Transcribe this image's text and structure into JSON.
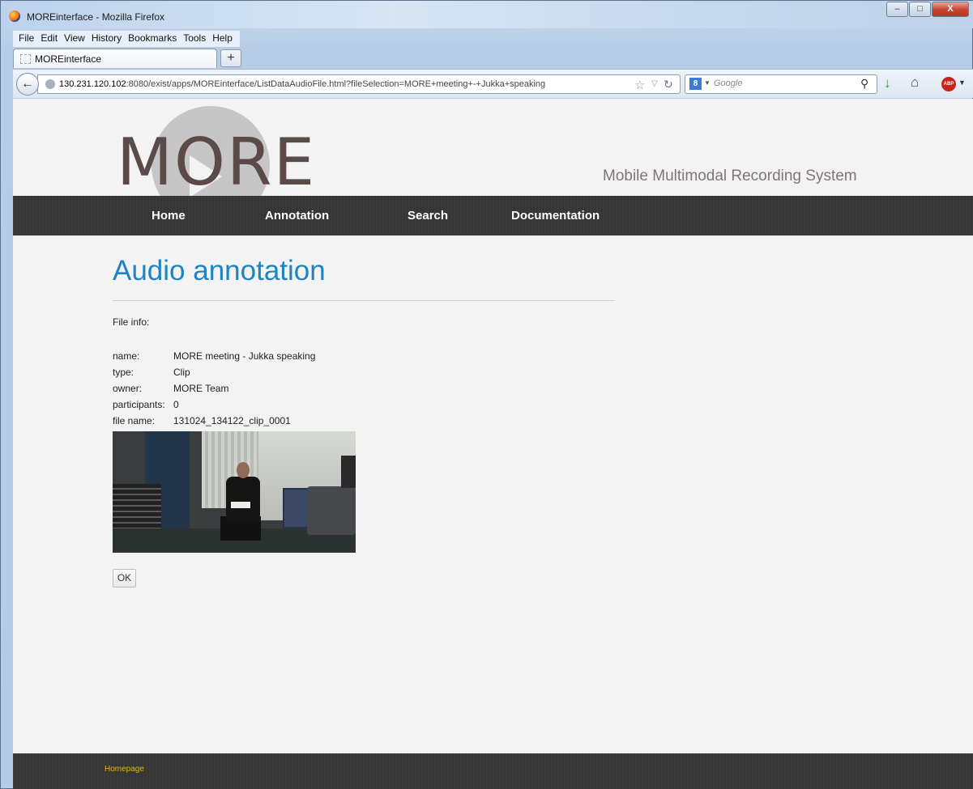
{
  "browser": {
    "window_title": "MOREinterface - Mozilla Firefox",
    "window_buttons": {
      "minimize": "–",
      "maximize": "□",
      "close": "X"
    },
    "menu": [
      "File",
      "Edit",
      "View",
      "History",
      "Bookmarks",
      "Tools",
      "Help"
    ],
    "tab_label": "MOREinterface",
    "new_tab": "+",
    "url_host": "130.231.120.102",
    "url_rest": ":8080/exist/apps/MOREinterface/ListDataAudioFile.html?fileSelection=MORE+meeting+-+Jukka+speaking",
    "search_engine": "8",
    "search_placeholder": "Google",
    "icons": [
      "back-icon",
      "globe-icon",
      "star-icon",
      "reload-icon",
      "google-icon",
      "search-icon",
      "download-icon",
      "home-icon",
      "adblock-icon"
    ]
  },
  "site": {
    "logo": "MORE",
    "tagline": "Mobile Multimodal Recording System",
    "nav": [
      "Home",
      "Annotation",
      "Search",
      "Documentation"
    ],
    "footer_link": "Homepage"
  },
  "page": {
    "title": "Audio annotation",
    "file_info_label": "File info:",
    "info": [
      {
        "key": "name:",
        "value": "MORE meeting - Jukka speaking"
      },
      {
        "key": "type:",
        "value": "Clip"
      },
      {
        "key": "owner:",
        "value": "MORE Team"
      },
      {
        "key": "participants:",
        "value": "0"
      },
      {
        "key": "file name:",
        "value": "131024_134122_clip_0001"
      }
    ],
    "ok_button": "OK"
  },
  "colors": {
    "title_blue": "#1f84c3",
    "nav_bg": "#383838",
    "footer_link": "#e0b800",
    "logo": "#5a4a48"
  }
}
